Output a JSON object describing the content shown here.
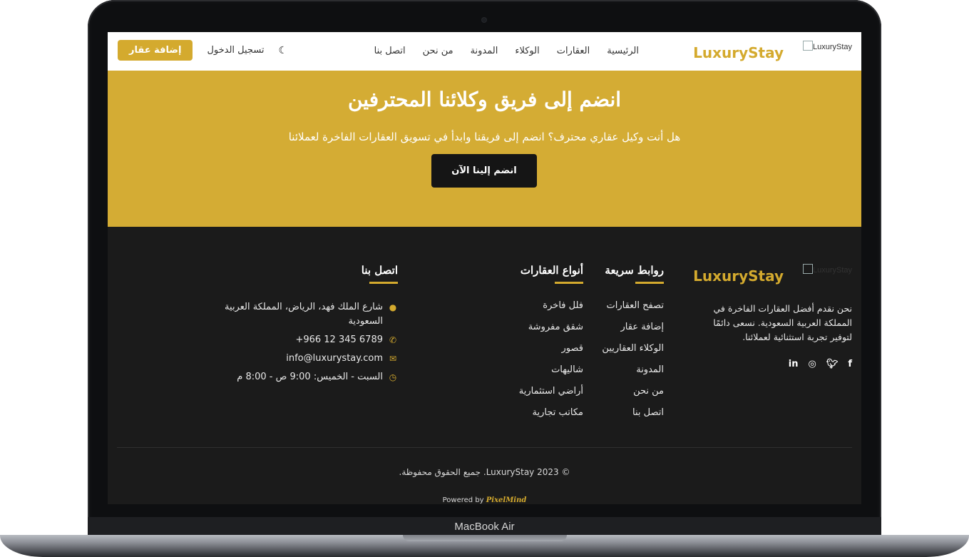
{
  "device": {
    "label": "MacBook Air"
  },
  "nav": {
    "brand_alt": "LuxuryStay",
    "brand": "LuxuryStay",
    "menu": [
      "الرئيسية",
      "العقارات",
      "الوكلاء",
      "المدونة",
      "من نحن",
      "اتصل بنا"
    ],
    "login": "تسجيل الدخول",
    "add_property": "إضافة عقار",
    "theme_icon": "moon-icon"
  },
  "hero": {
    "title": "انضم إلى فريق وكلائنا المحترفين",
    "subtitle": "هل أنت وكيل عقاري محترف؟ انضم إلى فريقنا وابدأ في تسويق العقارات الفاخرة لعملائنا",
    "cta": "انضم إلينا الآن"
  },
  "footer": {
    "brand_alt": "LuxuryStay",
    "brand": "LuxuryStay",
    "description": "نحن نقدم أفضل العقارات الفاخرة في المملكة العربية السعودية. نسعى دائمًا لتوفير تجربة استثنائية لعملائنا.",
    "socials": [
      "facebook-icon",
      "twitter-icon",
      "instagram-icon",
      "linkedin-icon"
    ],
    "quick_links": {
      "title": "روابط سريعة",
      "items": [
        "تصفح العقارات",
        "إضافة عقار",
        "الوكلاء العقاريين",
        "المدونة",
        "من نحن",
        "اتصل بنا"
      ]
    },
    "property_types": {
      "title": "أنواع العقارات",
      "items": [
        "فلل فاخرة",
        "شقق مفروشة",
        "قصور",
        "شاليهات",
        "أراضي استثمارية",
        "مكاتب تجارية"
      ]
    },
    "contact": {
      "title": "اتصل بنا",
      "address": "شارع الملك فهد، الرياض، المملكة العربية السعودية",
      "phone": "+966 12 345 6789",
      "email": "info@luxurystay.com",
      "hours": "السبت - الخميس: 9:00 ص - 8:00 م"
    },
    "copyright": "© 2023 LuxuryStay. جميع الحقوق محفوظة.",
    "powered_prefix": "Powered by",
    "powered_brand": "PixelMind"
  },
  "colors": {
    "accent": "#d4aa2e",
    "footer_bg": "#1b1b1b",
    "hero_bg": "#d4ac34"
  }
}
